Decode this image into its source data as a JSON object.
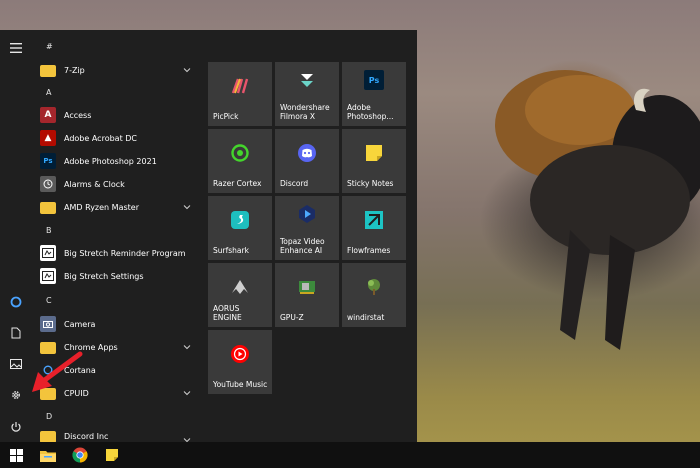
{
  "colors": {
    "menu_bg": "#1f1f1f",
    "tile_bg": "#3a3a3a",
    "taskbar_bg": "#101010",
    "folder": "#f3c43c",
    "arrow": "#e8202a"
  },
  "rail": {
    "items": [
      {
        "name": "hamburger-menu-icon"
      },
      {
        "name": "cortana-icon"
      },
      {
        "name": "documents-icon"
      },
      {
        "name": "pictures-icon"
      },
      {
        "name": "settings-gear-icon"
      },
      {
        "name": "power-icon"
      }
    ]
  },
  "applist": {
    "headers": [
      "#",
      "A",
      "B",
      "C",
      "D"
    ],
    "apps": [
      {
        "label": "7-Zip",
        "icon": "folder-icon",
        "expandable": true
      },
      {
        "label": "Access",
        "icon": "access-icon"
      },
      {
        "label": "Adobe Acrobat DC",
        "icon": "acrobat-icon"
      },
      {
        "label": "Adobe Photoshop 2021",
        "icon": "photoshop-icon"
      },
      {
        "label": "Alarms & Clock",
        "icon": "alarm-clock-icon"
      },
      {
        "label": "AMD Ryzen Master",
        "icon": "folder-icon",
        "expandable": true
      },
      {
        "label": "Big Stretch Reminder Program",
        "icon": "big-stretch-icon"
      },
      {
        "label": "Big Stretch Settings",
        "icon": "big-stretch-icon"
      },
      {
        "label": "Camera",
        "icon": "camera-icon"
      },
      {
        "label": "Chrome Apps",
        "icon": "folder-icon",
        "expandable": true
      },
      {
        "label": "Cortana",
        "icon": "cortana-icon"
      },
      {
        "label": "CPUID",
        "icon": "folder-icon",
        "expandable": true
      },
      {
        "label": "Discord Inc",
        "icon": "folder-icon",
        "expandable": true
      }
    ]
  },
  "tiles": [
    {
      "label": "PicPick",
      "icon": "picpick-icon"
    },
    {
      "label": "Wondershare Filmora X",
      "icon": "filmora-icon"
    },
    {
      "label": "Adobe Photoshop...",
      "icon": "photoshop-icon"
    },
    {
      "label": "Razer Cortex",
      "icon": "razer-cortex-icon"
    },
    {
      "label": "Discord",
      "icon": "discord-icon"
    },
    {
      "label": "Sticky Notes",
      "icon": "sticky-notes-icon"
    },
    {
      "label": "Surfshark",
      "icon": "surfshark-icon"
    },
    {
      "label": "Topaz Video Enhance AI",
      "icon": "topaz-icon"
    },
    {
      "label": "Flowframes",
      "icon": "flowframes-icon"
    },
    {
      "label": "AORUS ENGINE",
      "icon": "aorus-icon"
    },
    {
      "label": "GPU-Z",
      "icon": "gpuz-icon"
    },
    {
      "label": "windirstat",
      "icon": "windirstat-icon"
    },
    {
      "label": "YouTube Music",
      "icon": "youtube-music-icon"
    }
  ],
  "taskbar": {
    "items": [
      {
        "name": "windows-start-icon"
      },
      {
        "name": "file-explorer-icon"
      },
      {
        "name": "chrome-icon"
      },
      {
        "name": "sticky-notes-icon"
      }
    ]
  }
}
